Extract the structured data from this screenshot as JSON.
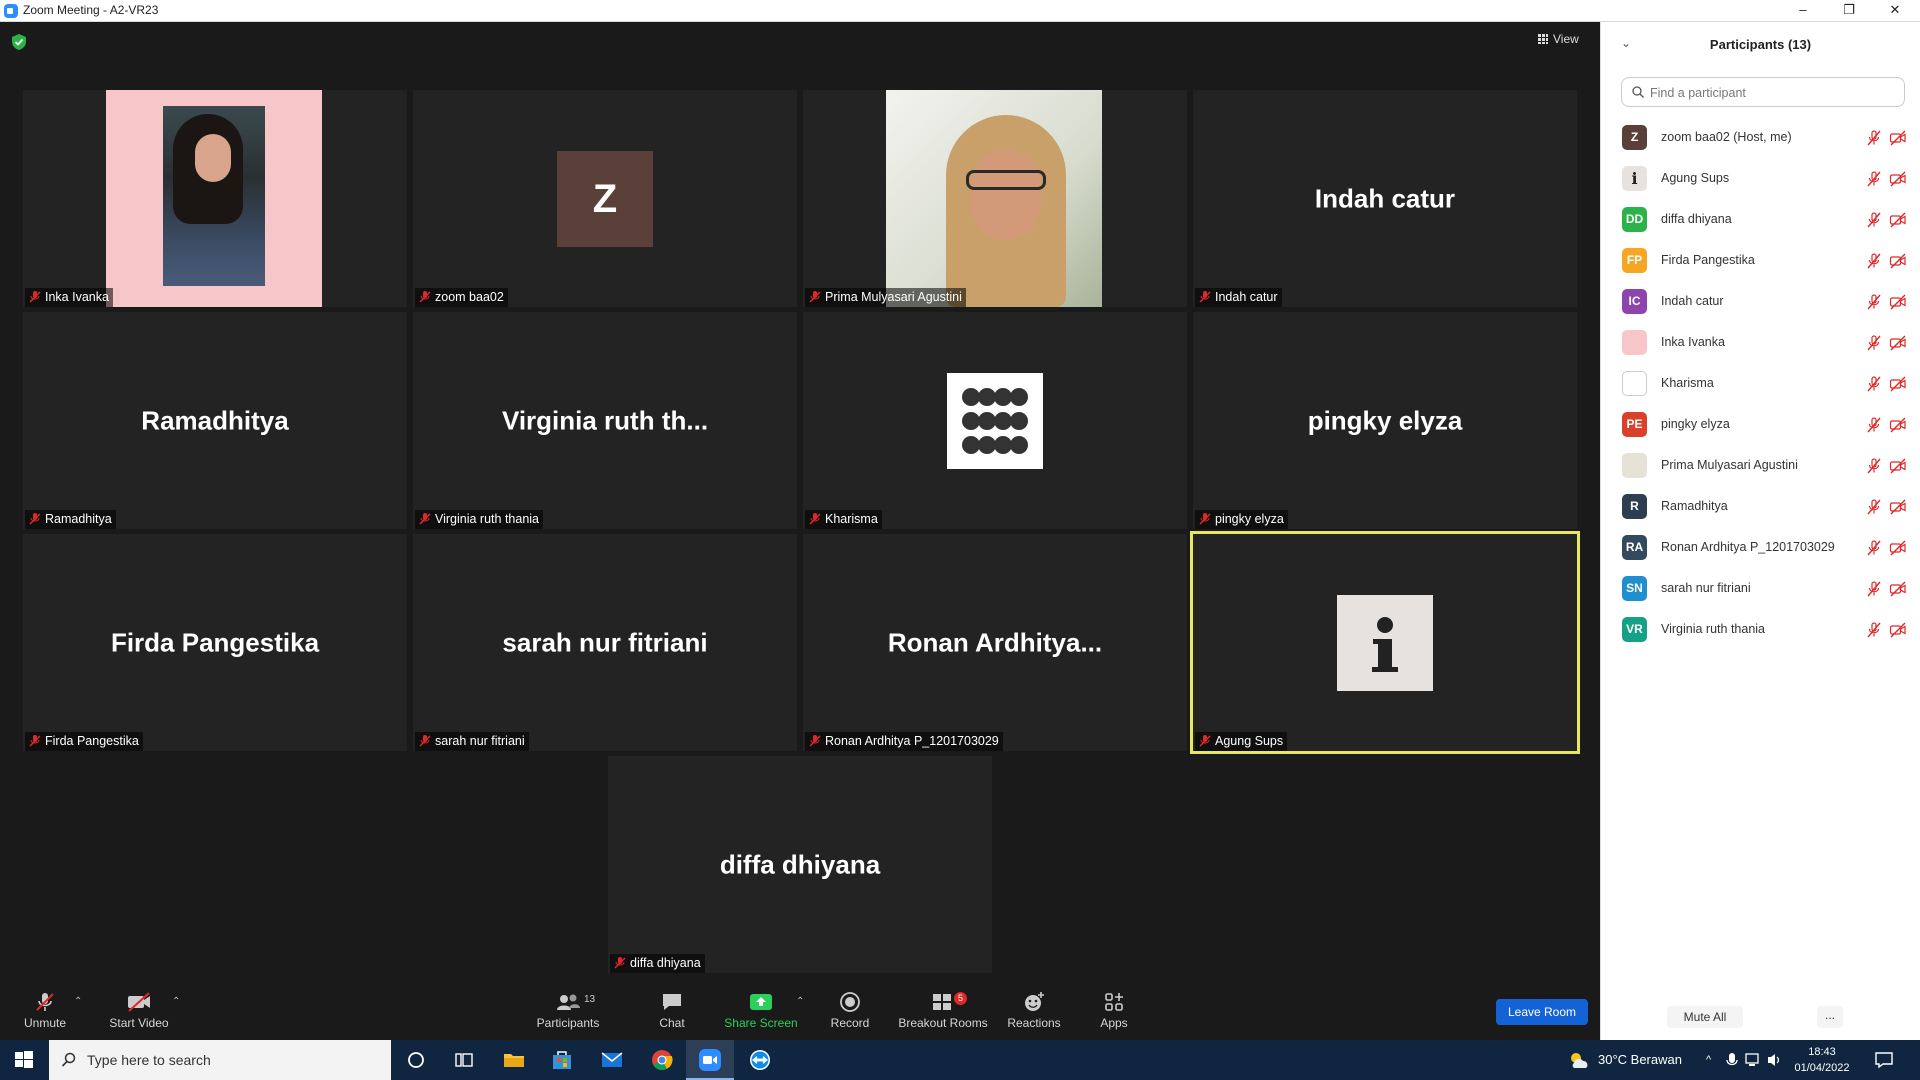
{
  "window": {
    "title": "Zoom Meeting - A2-VR23",
    "minimize": "–",
    "restore": "❐",
    "close": "✕"
  },
  "top": {
    "view_label": "View"
  },
  "tiles": [
    {
      "display": "",
      "label": "Inka Ivanka"
    },
    {
      "display": "",
      "label": "zoom baa02",
      "avatar_letter": "Z",
      "avatar_color": "#5a4038"
    },
    {
      "display": "",
      "label": "Prima Mulyasari Agustini"
    },
    {
      "display": "Indah catur",
      "label": "Indah catur"
    },
    {
      "display": "Ramadhitya",
      "label": "Ramadhitya"
    },
    {
      "display": "Virginia ruth th...",
      "label": "Virginia ruth thania"
    },
    {
      "display": "",
      "label": "Kharisma"
    },
    {
      "display": "pingky elyza",
      "label": "pingky elyza"
    },
    {
      "display": "Firda Pangestika",
      "label": "Firda Pangestika"
    },
    {
      "display": "sarah nur fitriani",
      "label": "sarah nur fitriani"
    },
    {
      "display": "Ronan  Ardhitya...",
      "label": "Ronan Ardhitya P_1201703029"
    },
    {
      "display": "",
      "label": "Agung Sups",
      "active": true
    },
    {
      "display": "diffa dhiyana",
      "label": "diffa dhiyana"
    }
  ],
  "toolbar": {
    "unmute": "Unmute",
    "start_video": "Start Video",
    "participants": "Participants",
    "participants_count": "13",
    "chat": "Chat",
    "share_screen": "Share Screen",
    "record": "Record",
    "breakout_rooms": "Breakout Rooms",
    "breakout_badge": "5",
    "reactions": "Reactions",
    "apps": "Apps",
    "leave_room": "Leave Room"
  },
  "panel": {
    "title": "Participants (13)",
    "search_placeholder": "Find a participant",
    "participants": [
      {
        "name": "zoom baa02 (Host, me)",
        "initials": "Z",
        "color": "#5a4038"
      },
      {
        "name": "Agung Sups",
        "initials": "i",
        "color": "#e8e2de"
      },
      {
        "name": "diffa dhiyana",
        "initials": "DD",
        "color": "#2bb34a"
      },
      {
        "name": "Firda Pangestika",
        "initials": "FP",
        "color": "#f5a623"
      },
      {
        "name": "Indah catur",
        "initials": "IC",
        "color": "#8e44ad"
      },
      {
        "name": "Inka Ivanka",
        "initials": "",
        "color": "#f7c6c8"
      },
      {
        "name": "Kharisma",
        "initials": "",
        "color": "#ffffff"
      },
      {
        "name": "pingky elyza",
        "initials": "PE",
        "color": "#d9412b"
      },
      {
        "name": "Prima Mulyasari Agustini",
        "initials": "",
        "color": "#e6e2d5"
      },
      {
        "name": "Ramadhitya",
        "initials": "R",
        "color": "#2c3e50"
      },
      {
        "name": "Ronan Ardhitya P_1201703029",
        "initials": "RA",
        "color": "#34495e"
      },
      {
        "name": "sarah nur fitriani",
        "initials": "SN",
        "color": "#1f8fd0"
      },
      {
        "name": "Virginia ruth thania",
        "initials": "VR",
        "color": "#16a085"
      }
    ],
    "mute_all": "Mute All",
    "more": "..."
  },
  "taskbar": {
    "search_placeholder": "Type here to search",
    "weather": "30°C  Berawan",
    "time": "18:43",
    "date": "01/04/2022"
  },
  "colors": {
    "accent": "#2d8cff",
    "active_speaker": "#e6e85f",
    "muted_red": "#e02828",
    "share_green": "#2bcf5a",
    "leave_blue": "#1463d6"
  }
}
